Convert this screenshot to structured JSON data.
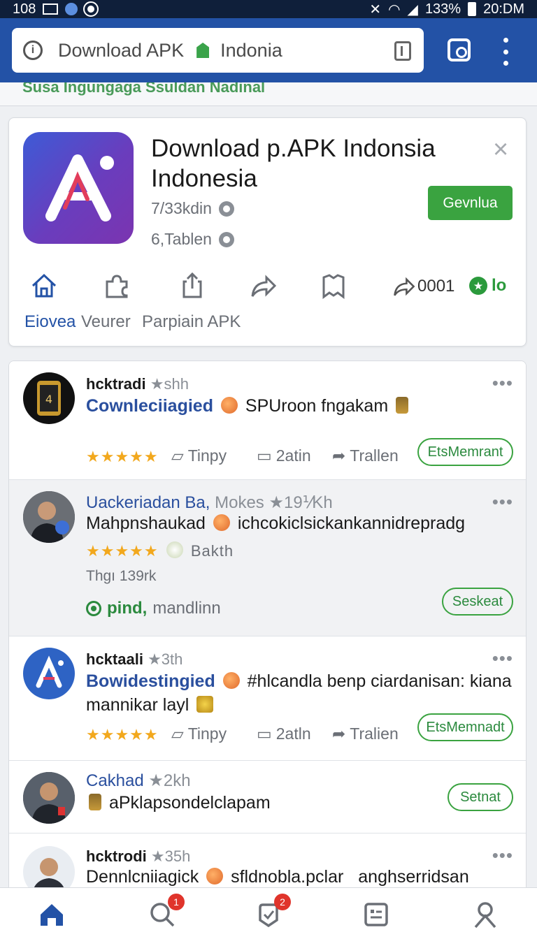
{
  "status_bar": {
    "left_text": "108",
    "battery": "133%",
    "time": "20:DM"
  },
  "browser": {
    "url_text": "Download APK",
    "site_name": "Indonia"
  },
  "peek_text": "Susa Ingungaga Ssuldan Nadinal",
  "app": {
    "title": "Download p.APK Indonsia Indonesia",
    "meta1": "7/33kdin",
    "meta2": "6,Tablen",
    "get_label": "Gevnlua",
    "close_label": "×",
    "actions": [
      {
        "icon": "home-icon",
        "label": "Eiovea"
      },
      {
        "icon": "puzzle-icon",
        "label": "Veurer"
      },
      {
        "icon": "upload-icon",
        "label": "Parpiain APK"
      },
      {
        "icon": "share-arrow-icon",
        "label": ""
      },
      {
        "icon": "bookmark-icon",
        "label": ""
      }
    ],
    "share_count": "0001",
    "io_label": "lo"
  },
  "posts": [
    {
      "author": "hcktradi",
      "meta": "shh",
      "text_link": "Cownleciiagied",
      "text_rest": "SPUroon fngakam",
      "stars": "★★★★★",
      "like": "Tinpy",
      "comment": "2atin",
      "share": "Trallen",
      "pill": "EtsMemrant"
    },
    {
      "author": "Uackeriadan Ba,",
      "meta": "Mokes ★19⅟Kh",
      "text_pre": "Mahpnshaukad",
      "text_rest": "ichcokiclsickankannidrepradg",
      "stars": "★★★★★",
      "tag": "Bakth",
      "subline": "Thgı 139rk",
      "pind": "pind,",
      "pind_rest": "mandlinn",
      "pill": "Seskeat"
    },
    {
      "author": "hcktaali",
      "meta": "3th",
      "text_link": "Bowidestingied",
      "text_rest": "#hlcandla benp ciardanisan: kiana",
      "text_line2": "mannikar  layl",
      "stars": "★★★★★",
      "like": "Tinpy",
      "comment": "2atln",
      "share": "Tralien",
      "pill": "EtsMemnadt"
    },
    {
      "author": "Cakhad",
      "meta": "2kh",
      "text_rest": "aPklapsondelclapam",
      "pill": "Setnat"
    },
    {
      "author": "hcktrodi",
      "meta": "35h",
      "text_link": "Dennlcniiagick",
      "text_rest": "sfldnobla.pclar",
      "text_extra": "anghserridsan"
    }
  ],
  "more_label": "•••",
  "bottom_nav": [
    {
      "icon": "home-icon",
      "badge": ""
    },
    {
      "icon": "search-icon",
      "badge": "1"
    },
    {
      "icon": "notification-icon",
      "badge": "2"
    },
    {
      "icon": "apps-icon",
      "badge": ""
    },
    {
      "icon": "profile-icon",
      "badge": ""
    }
  ],
  "colors": {
    "accent": "#2352a6",
    "green": "#3aa340",
    "star": "#f2a81d"
  }
}
